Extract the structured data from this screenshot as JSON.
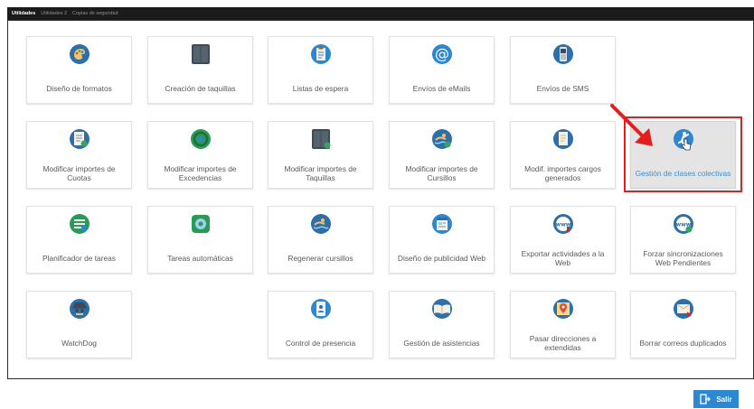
{
  "tabs": [
    "Utilidades",
    "Utilidades 2",
    "Copias de seguridad"
  ],
  "tiles": [
    {
      "label": "Diseño de formatos",
      "icon": "palette-icon"
    },
    {
      "label": "Creación de taquillas",
      "icon": "locker-icon"
    },
    {
      "label": "Listas de espera",
      "icon": "clipboard-icon"
    },
    {
      "label": "Envíos de eMails",
      "icon": "at-sign-icon"
    },
    {
      "label": "Envíos de SMS",
      "icon": "mobile-phone-icon"
    },
    {
      "label": "Modificar importes de Cuotas",
      "icon": "invoice-edit-icon"
    },
    {
      "label": "Modificar importes de Excedencias",
      "icon": "refresh-circle-icon"
    },
    {
      "label": "Modificar importes de Taquillas",
      "icon": "locker-edit-icon"
    },
    {
      "label": "Modificar importes de Cursillos",
      "icon": "swimmer-edit-icon"
    },
    {
      "label": "Modif. importes cargos generados",
      "icon": "document-edit-icon"
    },
    {
      "label": "Gestión de clases colectivas",
      "icon": "martial-arts-icon"
    },
    {
      "label": "Planificador de tareas",
      "icon": "task-list-icon"
    },
    {
      "label": "Tareas automáticas",
      "icon": "gear-box-icon"
    },
    {
      "label": "Regenerar cursillos",
      "icon": "swimmer-icon"
    },
    {
      "label": "Diseño de publicidad Web",
      "icon": "web-page-icon"
    },
    {
      "label": "Exportar actividades a la Web",
      "icon": "www-export-icon"
    },
    {
      "label": "Forzar sincronizaciones Web Pendientes",
      "icon": "www-sync-icon"
    },
    {
      "label": "WatchDog",
      "icon": "spy-icon"
    },
    {
      "label": "Control de presencia",
      "icon": "badge-icon"
    },
    {
      "label": "Gestión de asistencias",
      "icon": "open-book-icon"
    },
    {
      "label": "Pasar direcciones a extendidas",
      "icon": "map-pin-icon"
    },
    {
      "label": "Borrar correos duplicados",
      "icon": "delete-mail-icon"
    }
  ],
  "exit_label": "Salir",
  "colors": {
    "accent": "#2d87d1",
    "annotation": "#e02020",
    "topbar": "#1b1b1b"
  }
}
